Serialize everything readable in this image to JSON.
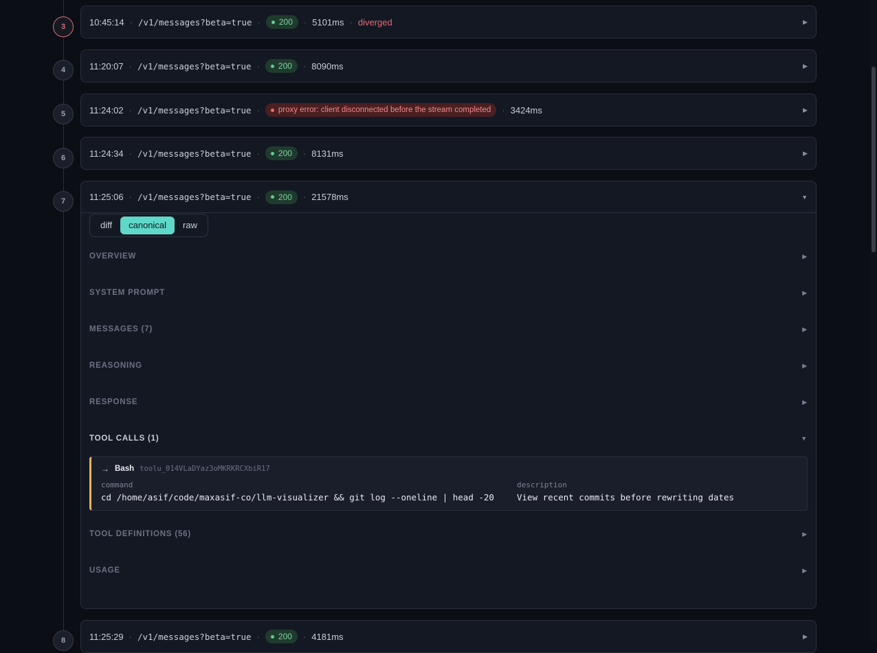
{
  "entries": [
    {
      "index": "3",
      "time": "10:45:14",
      "path": "/v1/messages?beta=true",
      "status": "200",
      "duration": "5101ms",
      "flag": "diverged"
    },
    {
      "index": "4",
      "time": "11:20:07",
      "path": "/v1/messages?beta=true",
      "status": "200",
      "duration": "8090ms"
    },
    {
      "index": "5",
      "time": "11:24:02",
      "path": "/v1/messages?beta=true",
      "status": "proxy error: client disconnected before the stream completed",
      "duration": "3424ms"
    },
    {
      "index": "6",
      "time": "11:24:34",
      "path": "/v1/messages?beta=true",
      "status": "200",
      "duration": "8131ms"
    },
    {
      "index": "7",
      "time": "11:25:06",
      "path": "/v1/messages?beta=true",
      "status": "200",
      "duration": "21578ms"
    },
    {
      "index": "8",
      "time": "11:25:29",
      "path": "/v1/messages?beta=true",
      "status": "200",
      "duration": "4181ms"
    }
  ],
  "separator": "·",
  "view_tabs": [
    "diff",
    "canonical",
    "raw"
  ],
  "active_view": "canonical",
  "sections": {
    "overview": "OVERVIEW",
    "system_prompt": "SYSTEM PROMPT",
    "messages": "MESSAGES (7)",
    "reasoning": "REASONING",
    "response": "RESPONSE",
    "tool_calls": "TOOL CALLS (1)",
    "tool_definitions": "TOOL DEFINITIONS (56)",
    "usage": "USAGE"
  },
  "tool_call": {
    "arrow": "→",
    "name": "Bash",
    "id": "toolu_014VLaDYaz3oMKRKRCXbiR17",
    "command_label": "command",
    "command": "cd /home/asif/code/maxasif-co/llm-visualizer && git log --oneline | head -20",
    "description_label": "description",
    "description": "View recent commits before rewriting dates"
  },
  "icons": {
    "collapsed": "chevron-right-icon",
    "expanded": "chevron-down-icon"
  },
  "colors": {
    "accent": "#5fd8c9",
    "success": "#5fd08f",
    "error": "#e06c75",
    "tool_accent": "#e3b55c"
  }
}
